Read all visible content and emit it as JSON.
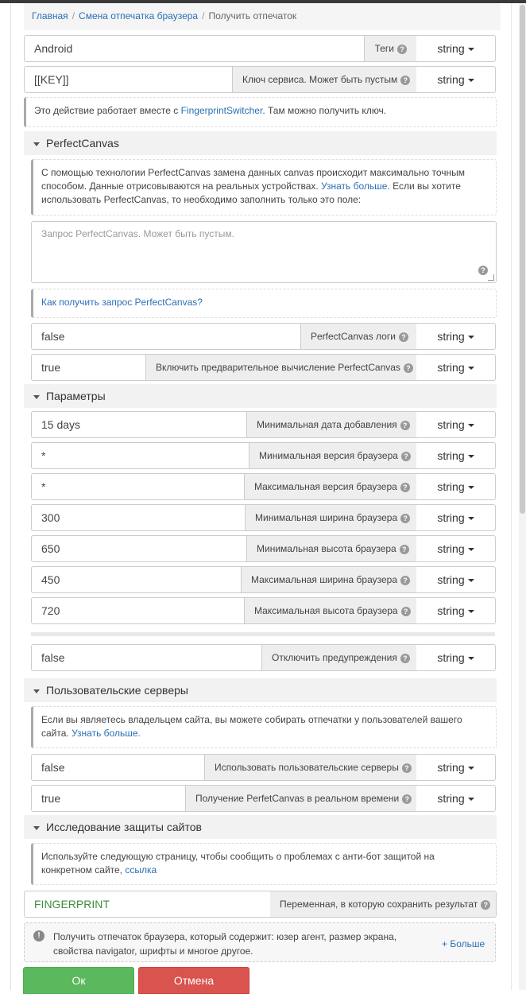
{
  "breadcrumb": {
    "home": "Главная",
    "parent": "Смена отпечатка браузера",
    "current": "Получить отпечаток",
    "sep": "/"
  },
  "type_label": "string",
  "tags": {
    "value": "Android",
    "label": "Теги"
  },
  "key": {
    "value": "[[KEY]]",
    "label": "Ключ сервиса. Может быть пустым"
  },
  "key_note": {
    "text_before": "Это действие работает вместе с ",
    "link": "FingerprintSwitcher",
    "text_after": ". Там можно получить ключ."
  },
  "perfectcanvas": {
    "title": "PerfectCanvas",
    "note_before": "С помощью технологии PerfectCanvas замена данных canvas происходит максимально точным способом. Данные отрисовываются на реальных устройствах. ",
    "note_link": "Узнать больше",
    "note_after": ". Если вы хотите использовать PerfectCanvas, то необходимо заполнить только это поле:",
    "request_placeholder": "Запрос PerfectCanvas. Может быть пустым.",
    "howto_link": "Как получить запрос PerfectCanvas?",
    "logs": {
      "value": "false",
      "label": "PerfectCanvas логи"
    },
    "precompute": {
      "value": "true",
      "label": "Включить предварительное вычисление PerfectCanvas"
    }
  },
  "params": {
    "title": "Параметры",
    "rows": [
      {
        "value": "15 days",
        "label": "Минимальная дата добавления"
      },
      {
        "value": "*",
        "label": "Минимальная версия браузера"
      },
      {
        "value": "*",
        "label": "Максимальная версия браузера"
      },
      {
        "value": "300",
        "label": "Минимальная ширина браузера"
      },
      {
        "value": "650",
        "label": "Минимальная высота браузера"
      },
      {
        "value": "450",
        "label": "Максимальная ширина браузера"
      },
      {
        "value": "720",
        "label": "Максимальная высота браузера"
      }
    ],
    "warnings": {
      "value": "false",
      "label": "Отключить предупреждения"
    }
  },
  "servers": {
    "title": "Пользовательские серверы",
    "note_before": "Если вы являетесь владельцем сайта, вы можете собирать отпечатки у пользователей вашего сайта. ",
    "note_link": "Узнать больше.",
    "use": {
      "value": "false",
      "label": "Использовать пользовательские серверы"
    },
    "realtime": {
      "value": "true",
      "label": "Получение PerfetCanvas в реальном времени"
    }
  },
  "research": {
    "title": "Исследование защиты сайтов",
    "note_before": "Используйте следующую страницу, чтобы сообщить о проблемах с анти-бот защитой на конкретном сайте, ",
    "note_link": "ссылка"
  },
  "result": {
    "value": "FINGERPRINT",
    "label": "Переменная, в которую сохранить результат"
  },
  "info": {
    "text": "Получить отпечаток браузера, который содержит: юзер агент, размер экрана, свойства navigator, шрифты и многое другое.",
    "more": "+ Больше"
  },
  "buttons": {
    "ok": "Ок",
    "cancel": "Отмена"
  },
  "colors": {
    "ok": "#5cb85c",
    "cancel": "#d9534f",
    "link": "#2a6fb5",
    "result_text": "#3c8f3c"
  }
}
